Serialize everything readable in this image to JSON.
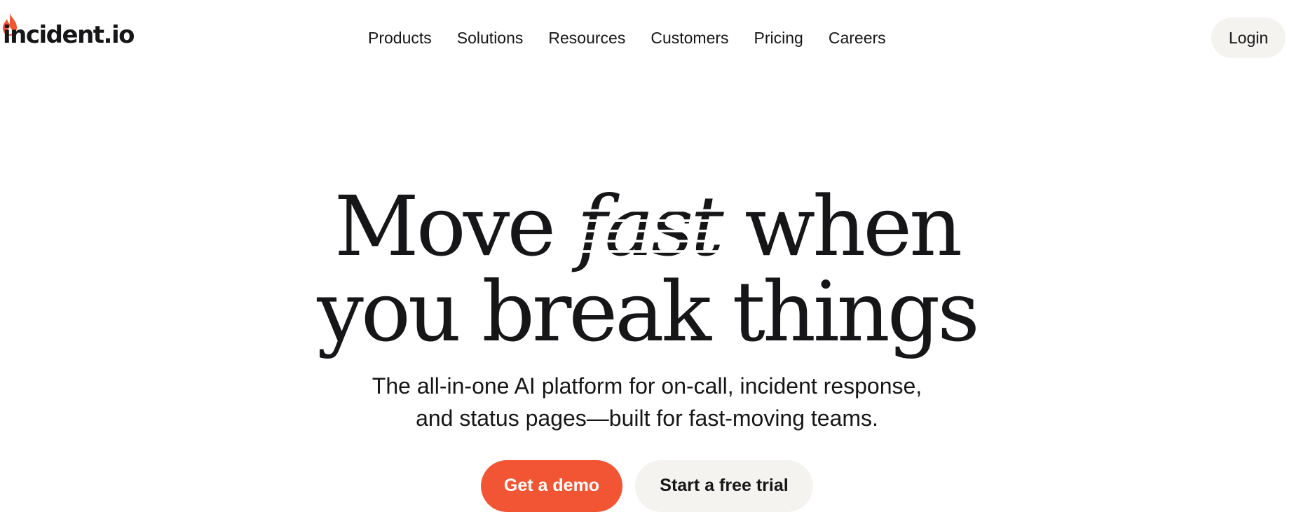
{
  "header": {
    "logo_text": "incident.io",
    "logo_icon": "flame-icon",
    "nav": [
      {
        "label": "Products"
      },
      {
        "label": "Solutions"
      },
      {
        "label": "Resources"
      },
      {
        "label": "Customers"
      },
      {
        "label": "Pricing"
      },
      {
        "label": "Careers"
      }
    ],
    "login_label": "Login"
  },
  "hero": {
    "title_line1_before": "Move",
    "title_emphasis": "fast",
    "title_line1_after": "when",
    "title_line2": "you break things",
    "subtitle_line1": "The all-in-one AI platform for on-call, incident response,",
    "subtitle_line2": "and status pages—built for fast-moving teams.",
    "cta_primary": "Get a demo",
    "cta_secondary": "Start a free trial"
  },
  "colors": {
    "brand_accent": "#f25533",
    "text": "#161618",
    "secondary_button_bg": "#f4f3f0",
    "background": "#ffffff"
  }
}
